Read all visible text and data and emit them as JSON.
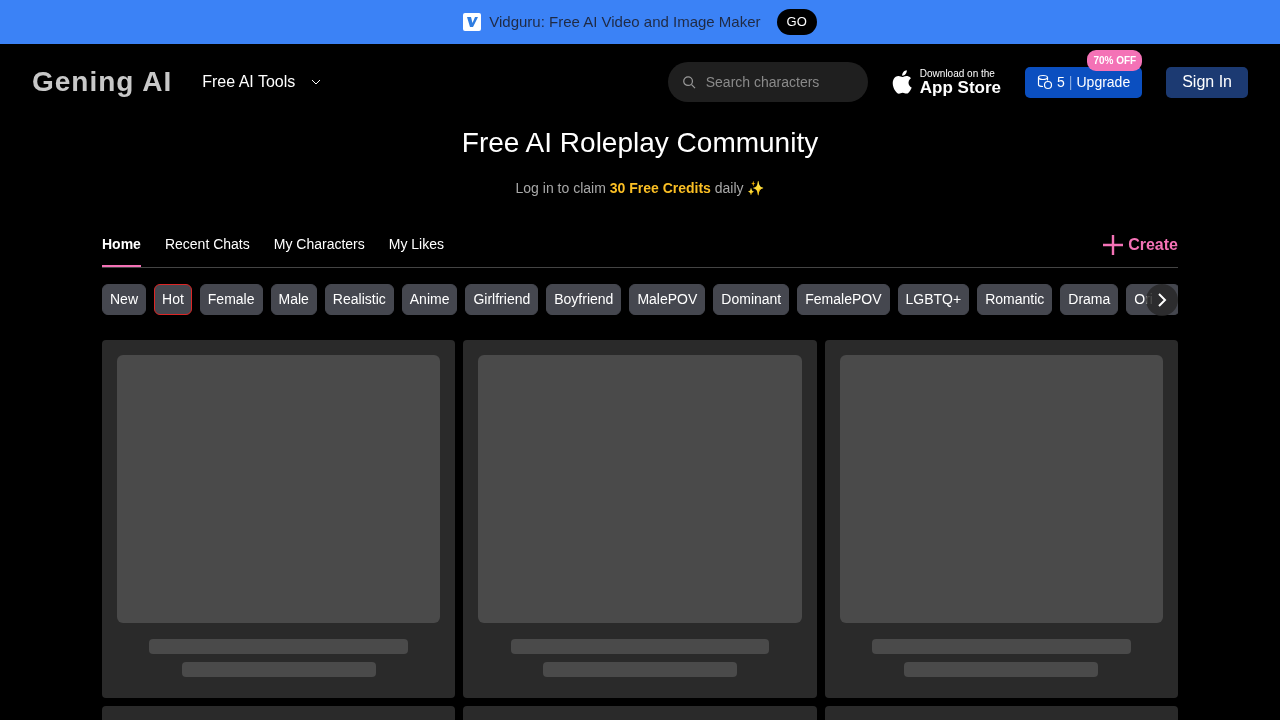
{
  "promo_banner": {
    "text": "Vidguru: Free AI Video and Image Maker",
    "button": "GO"
  },
  "navbar": {
    "logo": "Gening AI",
    "menu": "Free AI Tools",
    "search": {
      "placeholder": "Search characters"
    },
    "app_store": {
      "small": "Download on the",
      "large": "App Store"
    },
    "credits": "5",
    "separator": "|",
    "upgrade": "Upgrade",
    "discount_badge": "70% OFF",
    "sign_in": "Sign In"
  },
  "hero": {
    "title": "Free AI Roleplay Community",
    "subtitle": "Log in to claim **30 Free Credits** daily ✨"
  },
  "tabs": [
    {
      "label": "Home",
      "selected": true
    },
    {
      "label": "Recent Chats",
      "selected": false
    },
    {
      "label": "My Characters",
      "selected": false
    },
    {
      "label": "My Likes",
      "selected": false
    }
  ],
  "create_button": "Create",
  "categories": [
    {
      "label": "New",
      "selected": false
    },
    {
      "label": "Hot",
      "selected": true
    },
    {
      "label": "Female",
      "selected": false
    },
    {
      "label": "Male",
      "selected": false
    },
    {
      "label": "Realistic",
      "selected": false
    },
    {
      "label": "Anime",
      "selected": false
    },
    {
      "label": "Girlfriend",
      "selected": false
    },
    {
      "label": "Boyfriend",
      "selected": false
    },
    {
      "label": "MalePOV",
      "selected": false
    },
    {
      "label": "Dominant",
      "selected": false
    },
    {
      "label": "FemalePOV",
      "selected": false
    },
    {
      "label": "LGBTQ+",
      "selected": false
    },
    {
      "label": "Romantic",
      "selected": false
    },
    {
      "label": "Drama",
      "selected": false
    },
    {
      "label": "Ori",
      "selected": false
    }
  ],
  "cards": [
    {
      "kind": "skeleton"
    },
    {
      "kind": "skeleton"
    },
    {
      "kind": "skeleton"
    },
    {
      "kind": "edge"
    },
    {
      "kind": "edge"
    },
    {
      "kind": "edge"
    }
  ]
}
